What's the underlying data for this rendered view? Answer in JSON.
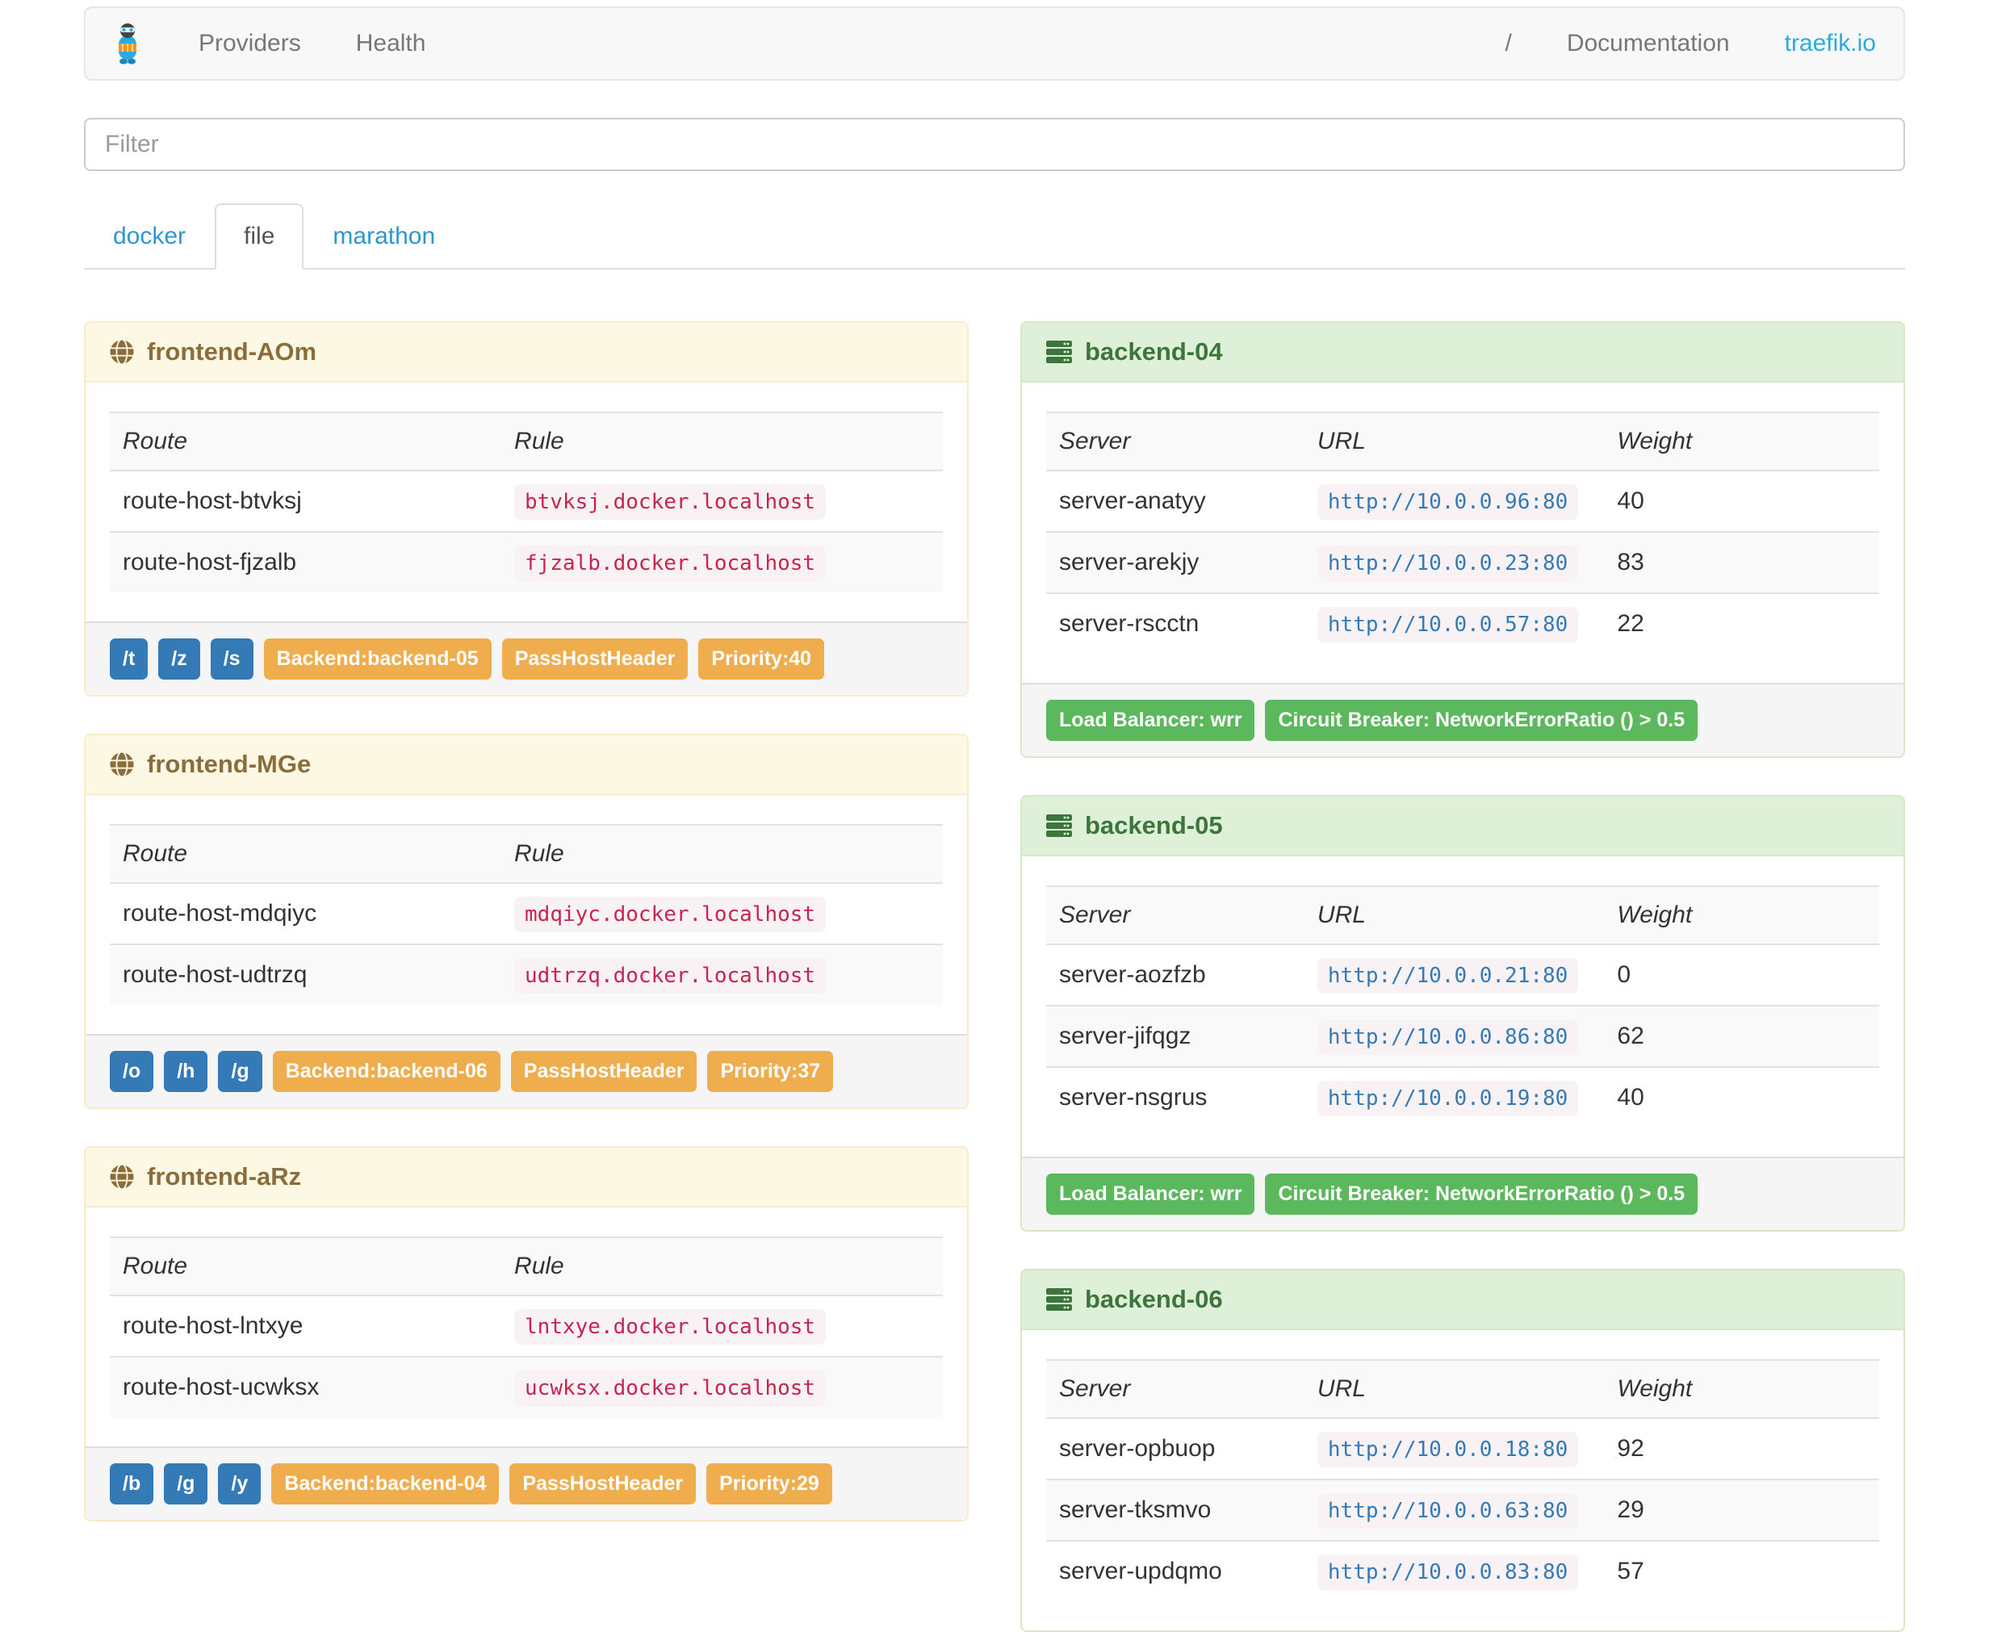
{
  "navbar": {
    "brand_icon": "traefik-logo",
    "links": [
      "Providers",
      "Health"
    ],
    "separator": "/",
    "documentation_label": "Documentation",
    "site_link": "traefik.io"
  },
  "filter": {
    "placeholder": "Filter"
  },
  "tabs": [
    {
      "label": "docker",
      "active": false
    },
    {
      "label": "file",
      "active": true
    },
    {
      "label": "marathon",
      "active": false
    }
  ],
  "frontend_panels": [
    {
      "title": "frontend-AOm",
      "icon": "globe-icon",
      "columns": [
        "Route",
        "Rule"
      ],
      "rows": [
        {
          "route": "route-host-btvksj",
          "rule": "btvksj.docker.localhost"
        },
        {
          "route": "route-host-fjzalb",
          "rule": "fjzalb.docker.localhost"
        }
      ],
      "path_badges": [
        "/t",
        "/z",
        "/s"
      ],
      "tag_badges": [
        "Backend:backend-05",
        "PassHostHeader",
        "Priority:40"
      ]
    },
    {
      "title": "frontend-MGe",
      "icon": "globe-icon",
      "columns": [
        "Route",
        "Rule"
      ],
      "rows": [
        {
          "route": "route-host-mdqiyc",
          "rule": "mdqiyc.docker.localhost"
        },
        {
          "route": "route-host-udtrzq",
          "rule": "udtrzq.docker.localhost"
        }
      ],
      "path_badges": [
        "/o",
        "/h",
        "/g"
      ],
      "tag_badges": [
        "Backend:backend-06",
        "PassHostHeader",
        "Priority:37"
      ]
    },
    {
      "title": "frontend-aRz",
      "icon": "globe-icon",
      "columns": [
        "Route",
        "Rule"
      ],
      "rows": [
        {
          "route": "route-host-lntxye",
          "rule": "lntxye.docker.localhost"
        },
        {
          "route": "route-host-ucwksx",
          "rule": "ucwksx.docker.localhost"
        }
      ],
      "path_badges": [
        "/b",
        "/g",
        "/y"
      ],
      "tag_badges": [
        "Backend:backend-04",
        "PassHostHeader",
        "Priority:29"
      ]
    }
  ],
  "backend_panels": [
    {
      "title": "backend-04",
      "icon": "server-icon",
      "columns": [
        "Server",
        "URL",
        "Weight"
      ],
      "rows": [
        {
          "server": "server-anatyy",
          "url": "http://10.0.0.96:80",
          "weight": "40"
        },
        {
          "server": "server-arekjy",
          "url": "http://10.0.0.23:80",
          "weight": "83"
        },
        {
          "server": "server-rscctn",
          "url": "http://10.0.0.57:80",
          "weight": "22"
        }
      ],
      "tag_badges": [
        "Load Balancer: wrr",
        "Circuit Breaker: NetworkErrorRatio () > 0.5"
      ]
    },
    {
      "title": "backend-05",
      "icon": "server-icon",
      "columns": [
        "Server",
        "URL",
        "Weight"
      ],
      "rows": [
        {
          "server": "server-aozfzb",
          "url": "http://10.0.0.21:80",
          "weight": "0"
        },
        {
          "server": "server-jifqgz",
          "url": "http://10.0.0.86:80",
          "weight": "62"
        },
        {
          "server": "server-nsgrus",
          "url": "http://10.0.0.19:80",
          "weight": "40"
        }
      ],
      "tag_badges": [
        "Load Balancer: wrr",
        "Circuit Breaker: NetworkErrorRatio () > 0.5"
      ]
    },
    {
      "title": "backend-06",
      "icon": "server-icon",
      "columns": [
        "Server",
        "URL",
        "Weight"
      ],
      "rows": [
        {
          "server": "server-opbuop",
          "url": "http://10.0.0.18:80",
          "weight": "92"
        },
        {
          "server": "server-tksmvo",
          "url": "http://10.0.0.63:80",
          "weight": "29"
        },
        {
          "server": "server-updqmo",
          "url": "http://10.0.0.83:80",
          "weight": "57"
        }
      ],
      "tag_badges": []
    }
  ],
  "colors": {
    "brand_blue": "#29abe2",
    "tab_link_blue": "#2f96d2",
    "badge_blue": "#337ab7",
    "badge_orange": "#f0ad4e",
    "badge_green": "#5cb85c",
    "frontend_header_bg": "#fcf8e3",
    "frontend_header_text": "#8a6d3b",
    "backend_header_bg": "#dff0d8",
    "backend_header_text": "#3c763d",
    "rule_code_text": "#c7254e",
    "url_code_text": "#337ab7",
    "code_bg": "#f9f2f4"
  }
}
